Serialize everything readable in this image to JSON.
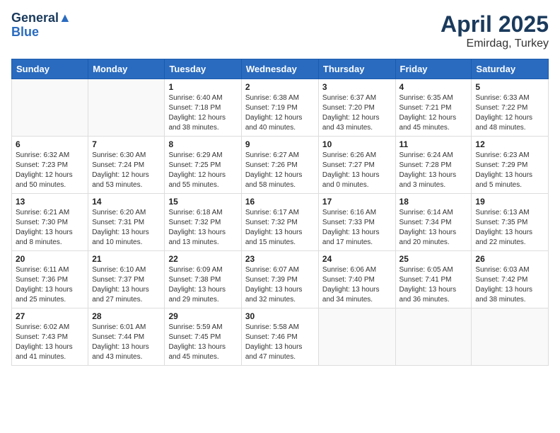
{
  "logo": {
    "line1": "General",
    "line2": "Blue"
  },
  "title": "April 2025",
  "location": "Emirdag, Turkey",
  "weekdays": [
    "Sunday",
    "Monday",
    "Tuesday",
    "Wednesday",
    "Thursday",
    "Friday",
    "Saturday"
  ],
  "weeks": [
    [
      {
        "day": "",
        "info": ""
      },
      {
        "day": "",
        "info": ""
      },
      {
        "day": "1",
        "info": "Sunrise: 6:40 AM\nSunset: 7:18 PM\nDaylight: 12 hours\nand 38 minutes."
      },
      {
        "day": "2",
        "info": "Sunrise: 6:38 AM\nSunset: 7:19 PM\nDaylight: 12 hours\nand 40 minutes."
      },
      {
        "day": "3",
        "info": "Sunrise: 6:37 AM\nSunset: 7:20 PM\nDaylight: 12 hours\nand 43 minutes."
      },
      {
        "day": "4",
        "info": "Sunrise: 6:35 AM\nSunset: 7:21 PM\nDaylight: 12 hours\nand 45 minutes."
      },
      {
        "day": "5",
        "info": "Sunrise: 6:33 AM\nSunset: 7:22 PM\nDaylight: 12 hours\nand 48 minutes."
      }
    ],
    [
      {
        "day": "6",
        "info": "Sunrise: 6:32 AM\nSunset: 7:23 PM\nDaylight: 12 hours\nand 50 minutes."
      },
      {
        "day": "7",
        "info": "Sunrise: 6:30 AM\nSunset: 7:24 PM\nDaylight: 12 hours\nand 53 minutes."
      },
      {
        "day": "8",
        "info": "Sunrise: 6:29 AM\nSunset: 7:25 PM\nDaylight: 12 hours\nand 55 minutes."
      },
      {
        "day": "9",
        "info": "Sunrise: 6:27 AM\nSunset: 7:26 PM\nDaylight: 12 hours\nand 58 minutes."
      },
      {
        "day": "10",
        "info": "Sunrise: 6:26 AM\nSunset: 7:27 PM\nDaylight: 13 hours\nand 0 minutes."
      },
      {
        "day": "11",
        "info": "Sunrise: 6:24 AM\nSunset: 7:28 PM\nDaylight: 13 hours\nand 3 minutes."
      },
      {
        "day": "12",
        "info": "Sunrise: 6:23 AM\nSunset: 7:29 PM\nDaylight: 13 hours\nand 5 minutes."
      }
    ],
    [
      {
        "day": "13",
        "info": "Sunrise: 6:21 AM\nSunset: 7:30 PM\nDaylight: 13 hours\nand 8 minutes."
      },
      {
        "day": "14",
        "info": "Sunrise: 6:20 AM\nSunset: 7:31 PM\nDaylight: 13 hours\nand 10 minutes."
      },
      {
        "day": "15",
        "info": "Sunrise: 6:18 AM\nSunset: 7:32 PM\nDaylight: 13 hours\nand 13 minutes."
      },
      {
        "day": "16",
        "info": "Sunrise: 6:17 AM\nSunset: 7:32 PM\nDaylight: 13 hours\nand 15 minutes."
      },
      {
        "day": "17",
        "info": "Sunrise: 6:16 AM\nSunset: 7:33 PM\nDaylight: 13 hours\nand 17 minutes."
      },
      {
        "day": "18",
        "info": "Sunrise: 6:14 AM\nSunset: 7:34 PM\nDaylight: 13 hours\nand 20 minutes."
      },
      {
        "day": "19",
        "info": "Sunrise: 6:13 AM\nSunset: 7:35 PM\nDaylight: 13 hours\nand 22 minutes."
      }
    ],
    [
      {
        "day": "20",
        "info": "Sunrise: 6:11 AM\nSunset: 7:36 PM\nDaylight: 13 hours\nand 25 minutes."
      },
      {
        "day": "21",
        "info": "Sunrise: 6:10 AM\nSunset: 7:37 PM\nDaylight: 13 hours\nand 27 minutes."
      },
      {
        "day": "22",
        "info": "Sunrise: 6:09 AM\nSunset: 7:38 PM\nDaylight: 13 hours\nand 29 minutes."
      },
      {
        "day": "23",
        "info": "Sunrise: 6:07 AM\nSunset: 7:39 PM\nDaylight: 13 hours\nand 32 minutes."
      },
      {
        "day": "24",
        "info": "Sunrise: 6:06 AM\nSunset: 7:40 PM\nDaylight: 13 hours\nand 34 minutes."
      },
      {
        "day": "25",
        "info": "Sunrise: 6:05 AM\nSunset: 7:41 PM\nDaylight: 13 hours\nand 36 minutes."
      },
      {
        "day": "26",
        "info": "Sunrise: 6:03 AM\nSunset: 7:42 PM\nDaylight: 13 hours\nand 38 minutes."
      }
    ],
    [
      {
        "day": "27",
        "info": "Sunrise: 6:02 AM\nSunset: 7:43 PM\nDaylight: 13 hours\nand 41 minutes."
      },
      {
        "day": "28",
        "info": "Sunrise: 6:01 AM\nSunset: 7:44 PM\nDaylight: 13 hours\nand 43 minutes."
      },
      {
        "day": "29",
        "info": "Sunrise: 5:59 AM\nSunset: 7:45 PM\nDaylight: 13 hours\nand 45 minutes."
      },
      {
        "day": "30",
        "info": "Sunrise: 5:58 AM\nSunset: 7:46 PM\nDaylight: 13 hours\nand 47 minutes."
      },
      {
        "day": "",
        "info": ""
      },
      {
        "day": "",
        "info": ""
      },
      {
        "day": "",
        "info": ""
      }
    ]
  ]
}
